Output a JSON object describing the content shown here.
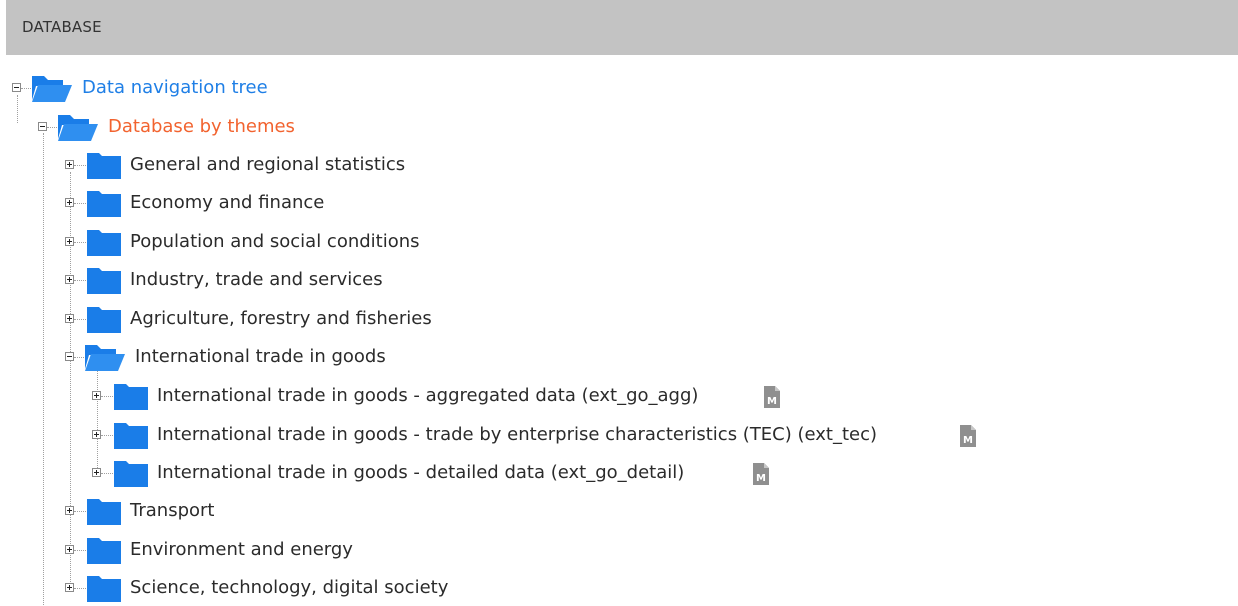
{
  "header": {
    "title": "DATABASE"
  },
  "tree": {
    "root": {
      "label": "Data navigation tree",
      "icon": "open-folder-icon",
      "expanded": true
    },
    "themes": {
      "label": "Database by themes",
      "icon": "open-folder-icon",
      "expanded": true
    },
    "items": [
      {
        "label": "General and regional statistics",
        "expanded": false
      },
      {
        "label": "Economy and finance",
        "expanded": false
      },
      {
        "label": "Population and social conditions",
        "expanded": false
      },
      {
        "label": "Industry, trade and services",
        "expanded": false
      },
      {
        "label": "Agriculture, forestry and fisheries",
        "expanded": false
      },
      {
        "label": "International trade in goods",
        "expanded": true,
        "children": [
          {
            "label": "International trade in goods - aggregated data (ext_go_agg)",
            "badge": "M"
          },
          {
            "label": "International trade in goods - trade by enterprise characteristics (TEC) (ext_tec)",
            "badge": "M"
          },
          {
            "label": "International trade in goods - detailed data (ext_go_detail)",
            "badge": "M"
          }
        ]
      },
      {
        "label": "Transport",
        "expanded": false
      },
      {
        "label": "Environment and energy",
        "expanded": false
      },
      {
        "label": "Science, technology, digital society",
        "expanded": false
      }
    ]
  },
  "colors": {
    "header_bg": "#c3c3c3",
    "folder_blue": "#1a7de8",
    "root_link": "#1f7fe6",
    "themes_link": "#f2632f",
    "text": "#2b2b2b"
  }
}
